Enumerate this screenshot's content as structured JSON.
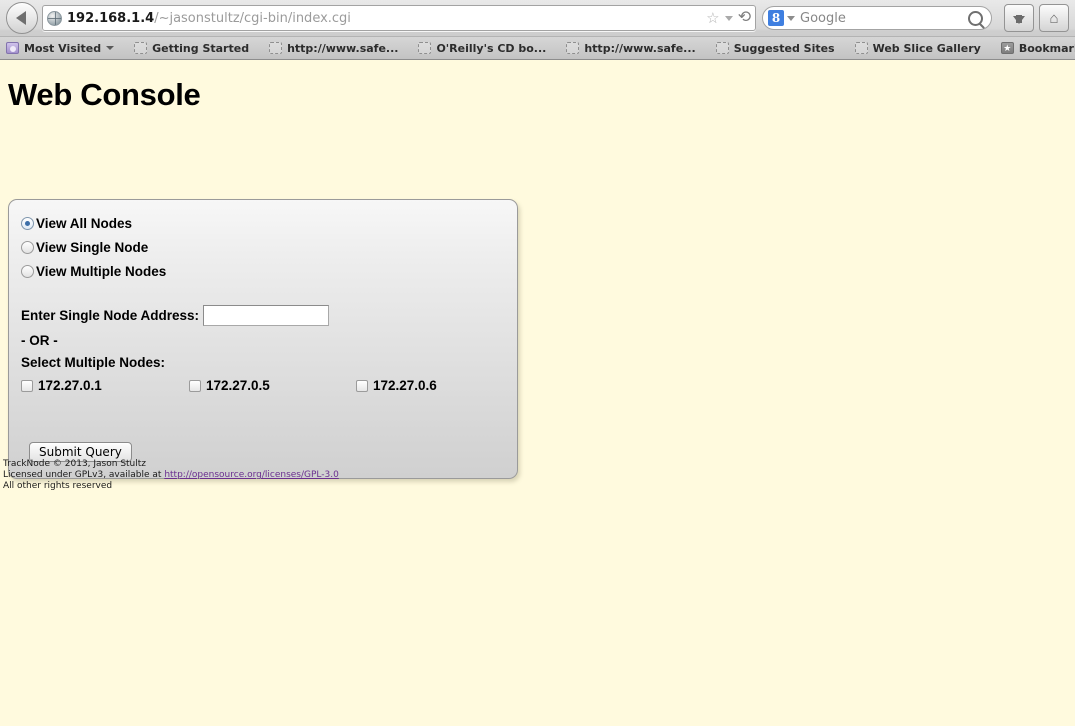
{
  "browser": {
    "back_button": "Back",
    "url": {
      "host": "192.168.1.4",
      "path": "/~jasonstultz/cgi-bin/index.cgi"
    },
    "star_glyph": "☆",
    "reload_glyph": "⟳",
    "search": {
      "engine_logo": "8",
      "label": "Google"
    },
    "download_button": "Downloads",
    "home_button": "Home",
    "bookmarks": [
      {
        "label": "Most Visited",
        "icon": "folder-icon",
        "has_caret": true
      },
      {
        "label": "Getting Started",
        "icon": "blank-icon",
        "has_caret": false
      },
      {
        "label": "http://www.safe...",
        "icon": "blank-icon",
        "has_caret": false
      },
      {
        "label": "O'Reilly's CD bo...",
        "icon": "blank-icon",
        "has_caret": false
      },
      {
        "label": "http://www.safe...",
        "icon": "blank-icon",
        "has_caret": false
      },
      {
        "label": "Suggested Sites",
        "icon": "blank-icon",
        "has_caret": false
      },
      {
        "label": "Web Slice Gallery",
        "icon": "blank-icon",
        "has_caret": false
      }
    ],
    "bookmarks_menu": {
      "label": "Bookmarks",
      "star_glyph": "★"
    }
  },
  "page": {
    "title": "Web Console",
    "radios": [
      {
        "label": "View All Nodes",
        "checked": true
      },
      {
        "label": "View Single Node",
        "checked": false
      },
      {
        "label": "View Multiple Nodes",
        "checked": false
      }
    ],
    "single_node": {
      "label": "Enter Single Node Address:",
      "value": "",
      "placeholder": ""
    },
    "or_separator": "- OR -",
    "multi_select_label": "Select Multiple Nodes:",
    "node_checkboxes": [
      {
        "label": "172.27.0.1",
        "checked": false
      },
      {
        "label": "172.27.0.5",
        "checked": false
      },
      {
        "label": "172.27.0.6",
        "checked": false
      }
    ],
    "submit_label": "Submit Query",
    "footer": {
      "line1": "TrackNode © 2013, Jason Stultz",
      "line2_prefix": "Licensed under GPLv3, available at ",
      "license_link": "http://opensource.org/licenses/GPL-3.0",
      "line3": "All other rights reserved"
    }
  },
  "colors": {
    "page_background": "#fffade",
    "panel_background": "#ededed",
    "link": "#6b2f8f",
    "radio_accent": "#3c6ea8"
  }
}
